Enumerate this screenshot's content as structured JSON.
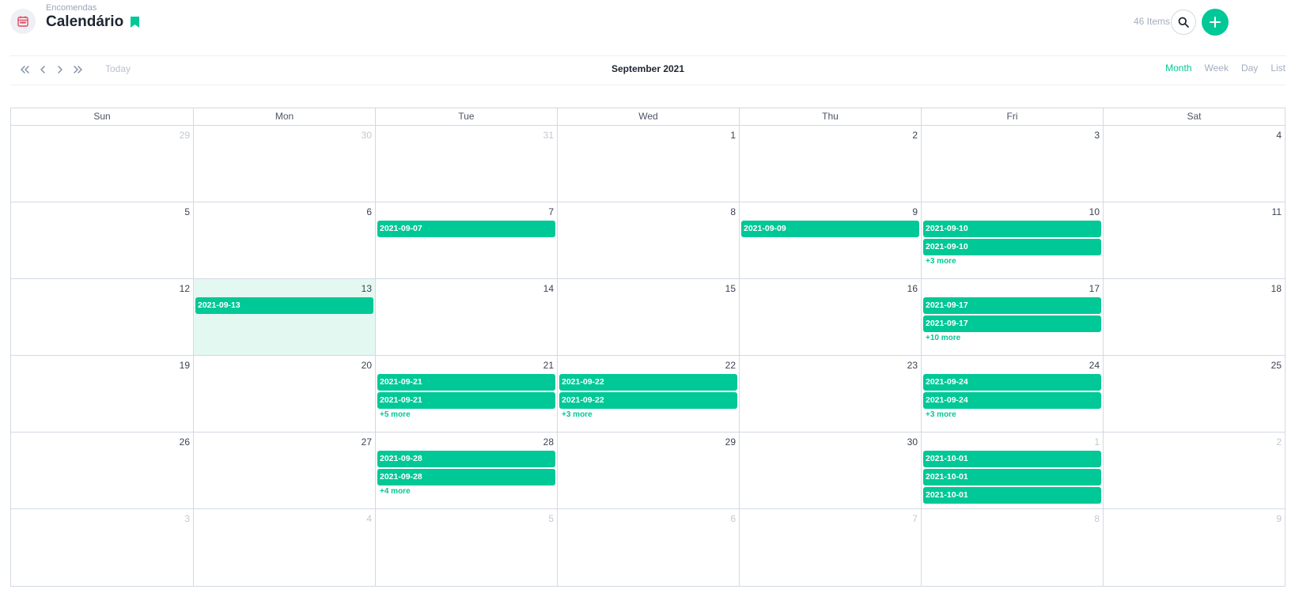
{
  "header": {
    "breadcrumb": "Encomendas",
    "title": "Calendário",
    "items_count": "46 Items",
    "app_icon": "calendar-icon",
    "accent_color": "#00c896"
  },
  "toolbar": {
    "today_label": "Today",
    "month_title": "September 2021",
    "views": [
      "Month",
      "Week",
      "Day",
      "List"
    ],
    "active_view": "Month"
  },
  "calendar": {
    "day_headers": [
      "Sun",
      "Mon",
      "Tue",
      "Wed",
      "Thu",
      "Fri",
      "Sat"
    ],
    "weeks": [
      [
        {
          "day": "29",
          "other": true
        },
        {
          "day": "30",
          "other": true
        },
        {
          "day": "31",
          "other": true
        },
        {
          "day": "1"
        },
        {
          "day": "2"
        },
        {
          "day": "3"
        },
        {
          "day": "4"
        }
      ],
      [
        {
          "day": "5"
        },
        {
          "day": "6"
        },
        {
          "day": "7",
          "events": [
            "2021-09-07"
          ]
        },
        {
          "day": "8"
        },
        {
          "day": "9",
          "events": [
            "2021-09-09"
          ]
        },
        {
          "day": "10",
          "events": [
            "2021-09-10",
            "2021-09-10"
          ],
          "more": "+3 more"
        },
        {
          "day": "11"
        }
      ],
      [
        {
          "day": "12"
        },
        {
          "day": "13",
          "today": true,
          "events": [
            "2021-09-13"
          ]
        },
        {
          "day": "14"
        },
        {
          "day": "15"
        },
        {
          "day": "16"
        },
        {
          "day": "17",
          "events": [
            "2021-09-17",
            "2021-09-17"
          ],
          "more": "+10 more"
        },
        {
          "day": "18"
        }
      ],
      [
        {
          "day": "19"
        },
        {
          "day": "20"
        },
        {
          "day": "21",
          "events": [
            "2021-09-21",
            "2021-09-21"
          ],
          "more": "+5 more"
        },
        {
          "day": "22",
          "events": [
            "2021-09-22",
            "2021-09-22"
          ],
          "more": "+3 more"
        },
        {
          "day": "23"
        },
        {
          "day": "24",
          "events": [
            "2021-09-24",
            "2021-09-24"
          ],
          "more": "+3 more"
        },
        {
          "day": "25"
        }
      ],
      [
        {
          "day": "26"
        },
        {
          "day": "27"
        },
        {
          "day": "28",
          "events": [
            "2021-09-28",
            "2021-09-28"
          ],
          "more": "+4 more"
        },
        {
          "day": "29"
        },
        {
          "day": "30"
        },
        {
          "day": "1",
          "other": true,
          "events": [
            "2021-10-01",
            "2021-10-01",
            "2021-10-01"
          ]
        },
        {
          "day": "2",
          "other": true
        }
      ],
      [
        {
          "day": "3",
          "other": true
        },
        {
          "day": "4",
          "other": true
        },
        {
          "day": "5",
          "other": true
        },
        {
          "day": "6",
          "other": true
        },
        {
          "day": "7",
          "other": true
        },
        {
          "day": "8",
          "other": true
        },
        {
          "day": "9",
          "other": true
        }
      ]
    ]
  }
}
